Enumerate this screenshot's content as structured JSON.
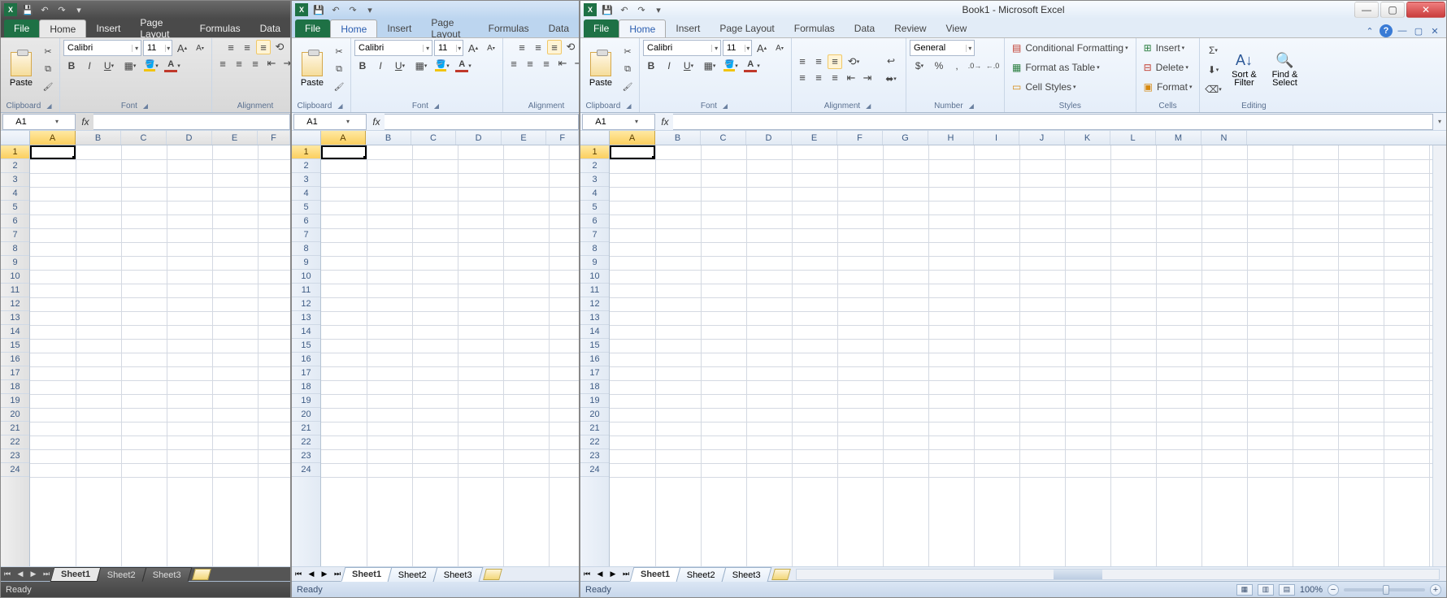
{
  "title": "Book1 - Microsoft Excel",
  "tabs": {
    "file": "File",
    "home": "Home",
    "insert": "Insert",
    "pagelayout": "Page Layout",
    "formulas": "Formulas",
    "data": "Data",
    "review": "Review",
    "view": "View"
  },
  "ribbon": {
    "clipboard": {
      "label": "Clipboard",
      "paste": "Paste"
    },
    "font": {
      "label": "Font",
      "name": "Calibri",
      "size": "11",
      "bold": "B",
      "italic": "I",
      "underline": "U",
      "growA": "A",
      "shrinkA": "A"
    },
    "alignment": {
      "label": "Alignment"
    },
    "number": {
      "label": "Number",
      "fmt": "General",
      "percent": "%",
      "comma": ","
    },
    "styles": {
      "label": "Styles",
      "cond": "Conditional Formatting",
      "table": "Format as Table",
      "cellstyles": "Cell Styles"
    },
    "cells": {
      "label": "Cells",
      "insert": "Insert",
      "delete": "Delete",
      "format": "Format"
    },
    "editing": {
      "label": "Editing",
      "sigma": "Σ",
      "sort": "Sort & Filter",
      "find": "Find & Select"
    }
  },
  "namebox": "A1",
  "fx": "fx",
  "columns": [
    "A",
    "B",
    "C",
    "D",
    "E",
    "F",
    "G",
    "H",
    "I",
    "J",
    "K",
    "L",
    "M",
    "N"
  ],
  "rows_short": 24,
  "rows_long": 24,
  "sheets": {
    "s1": "Sheet1",
    "s2": "Sheet2",
    "s3": "Sheet3"
  },
  "status": {
    "ready": "Ready",
    "zoom": "100%"
  },
  "arrow": "▾",
  "caret": "▸"
}
